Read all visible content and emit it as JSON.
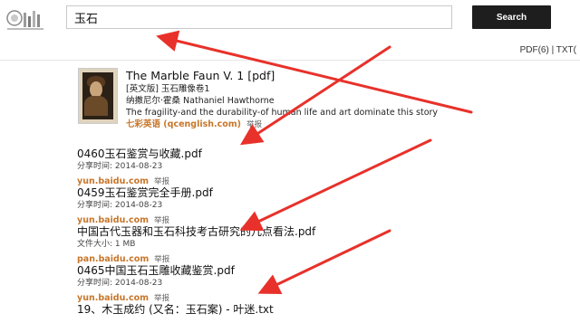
{
  "search": {
    "query": "玉石",
    "button_label": "Search"
  },
  "filters": {
    "pdf": "PDF(6)",
    "separator": " | ",
    "txt": "TXT("
  },
  "book": {
    "title": "The Marble Faun V. 1 [pdf]",
    "subtitle": "[英文版] 玉石雕像卷1",
    "author": "纳撒尼尔·霍桑 Nathaniel Hawthorne",
    "description": "The fragility-and the durability-of human life and art dominate this story",
    "source": "七彩英语 (qcenglish.com)",
    "report": "举报"
  },
  "results": [
    {
      "title": "0460玉石鉴赏与收藏.pdf",
      "meta": "分享时间: 2014-08-23",
      "source": "yun.baidu.com",
      "report": "举报"
    },
    {
      "title": "0459玉石鉴赏完全手册.pdf",
      "meta": "分享时间: 2014-08-23",
      "source": "yun.baidu.com",
      "report": "举报"
    },
    {
      "title": "中国古代玉器和玉石科技考古研究的几点看法.pdf",
      "meta": "文件大小: 1 MB",
      "source": "pan.baidu.com",
      "report": "举报"
    },
    {
      "title": "0465中国玉石玉雕收藏鉴赏.pdf",
      "meta": "分享时间: 2014-08-23",
      "source": "yun.baidu.com",
      "report": "举报"
    },
    {
      "title": "19、木玉成约 (又名：玉石案) - 叶迷.txt",
      "meta": "",
      "source": "",
      "report": ""
    }
  ],
  "colors": {
    "arrow": "#e8312a",
    "source_link": "#c8762a",
    "button": "#1e1e1e"
  },
  "icons": {
    "logo": "site-logo-icon"
  }
}
